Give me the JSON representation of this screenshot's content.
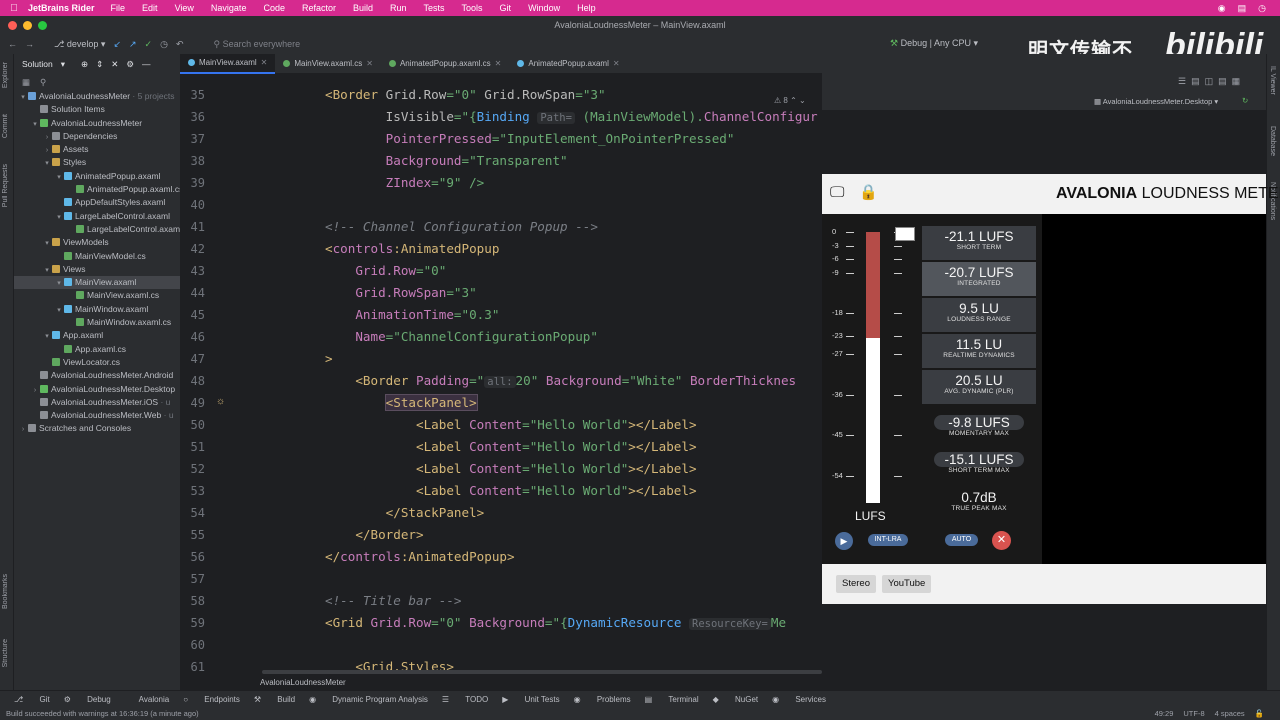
{
  "menubar": {
    "app": "JetBrains Rider",
    "items": [
      "File",
      "Edit",
      "View",
      "Navigate",
      "Code",
      "Refactor",
      "Build",
      "Run",
      "Tests",
      "Tools",
      "Git",
      "Window",
      "Help"
    ]
  },
  "window_title": "AvaloniaLoudnessMeter – MainView.axaml",
  "toolbar": {
    "branch": "develop",
    "search_placeholder": "Search everywhere",
    "run_config": "Debug | Any CPU"
  },
  "watermark": {
    "text": "明文传输不",
    "logo": "bilibili"
  },
  "sidebar": {
    "title": "Solution",
    "tree": [
      {
        "indent": 0,
        "arrow": "▾",
        "label": "AvaloniaLoudnessMeter",
        "suffix": " · 5 projects",
        "color": "#6aa0d8"
      },
      {
        "indent": 1,
        "arrow": "",
        "label": "Solution Items",
        "suffix": "",
        "color": "#8c8f95"
      },
      {
        "indent": 1,
        "arrow": "▾",
        "label": "AvaloniaLoudnessMeter",
        "suffix": "",
        "color": "#5fb85f"
      },
      {
        "indent": 2,
        "arrow": "›",
        "label": "Dependencies",
        "suffix": "",
        "color": "#8c8f95"
      },
      {
        "indent": 2,
        "arrow": "›",
        "label": "Assets",
        "suffix": "",
        "color": "#c9a24a"
      },
      {
        "indent": 2,
        "arrow": "▾",
        "label": "Styles",
        "suffix": "",
        "color": "#c9a24a"
      },
      {
        "indent": 3,
        "arrow": "▾",
        "label": "AnimatedPopup.axaml",
        "suffix": "",
        "color": "#5fb8e8"
      },
      {
        "indent": 4,
        "arrow": "",
        "label": "AnimatedPopup.axaml.cs",
        "suffix": "",
        "color": "#5fa85f"
      },
      {
        "indent": 3,
        "arrow": "",
        "label": "AppDefaultStyles.axaml",
        "suffix": "",
        "color": "#5fb8e8"
      },
      {
        "indent": 3,
        "arrow": "▾",
        "label": "LargeLabelControl.axaml",
        "suffix": "",
        "color": "#5fb8e8"
      },
      {
        "indent": 4,
        "arrow": "",
        "label": "LargeLabelControl.axaml.cs",
        "suffix": "",
        "color": "#5fa85f"
      },
      {
        "indent": 2,
        "arrow": "▾",
        "label": "ViewModels",
        "suffix": "",
        "color": "#c9a24a"
      },
      {
        "indent": 3,
        "arrow": "",
        "label": "MainViewModel.cs",
        "suffix": "",
        "color": "#5fa85f"
      },
      {
        "indent": 2,
        "arrow": "▾",
        "label": "Views",
        "suffix": "",
        "color": "#c9a24a"
      },
      {
        "indent": 3,
        "arrow": "▾",
        "label": "MainView.axaml",
        "suffix": "",
        "color": "#5fb8e8",
        "selected": true
      },
      {
        "indent": 4,
        "arrow": "",
        "label": "MainView.axaml.cs",
        "suffix": "",
        "color": "#5fa85f"
      },
      {
        "indent": 3,
        "arrow": "▾",
        "label": "MainWindow.axaml",
        "suffix": "",
        "color": "#5fb8e8"
      },
      {
        "indent": 4,
        "arrow": "",
        "label": "MainWindow.axaml.cs",
        "suffix": "",
        "color": "#5fa85f"
      },
      {
        "indent": 2,
        "arrow": "▾",
        "label": "App.axaml",
        "suffix": "",
        "color": "#5fb8e8"
      },
      {
        "indent": 3,
        "arrow": "",
        "label": "App.axaml.cs",
        "suffix": "",
        "color": "#5fa85f"
      },
      {
        "indent": 2,
        "arrow": "",
        "label": "ViewLocator.cs",
        "suffix": "",
        "color": "#5fa85f"
      },
      {
        "indent": 1,
        "arrow": "",
        "label": "AvaloniaLoudnessMeter.Android",
        "suffix": "",
        "color": "#8c8f95"
      },
      {
        "indent": 1,
        "arrow": "›",
        "label": "AvaloniaLoudnessMeter.Desktop",
        "suffix": "",
        "color": "#5fb85f"
      },
      {
        "indent": 1,
        "arrow": "",
        "label": "AvaloniaLoudnessMeter.iOS",
        "suffix": " · u",
        "color": "#8c8f95"
      },
      {
        "indent": 1,
        "arrow": "",
        "label": "AvaloniaLoudnessMeter.Web",
        "suffix": " · u",
        "color": "#8c8f95"
      },
      {
        "indent": 0,
        "arrow": "›",
        "label": "Scratches and Consoles",
        "suffix": "",
        "color": "#8c8f95"
      }
    ]
  },
  "tabs": [
    {
      "label": "MainView.axaml",
      "active": true
    },
    {
      "label": "MainView.axaml.cs",
      "active": false
    },
    {
      "label": "AnimatedPopup.axaml.cs",
      "active": false
    },
    {
      "label": "AnimatedPopup.axaml",
      "active": false
    }
  ],
  "preview": {
    "target": "AvaloniaLoudnessMeter.Desktop",
    "problems_badge": "8"
  },
  "editor": {
    "line_numbers": [
      "35",
      "36",
      "37",
      "38",
      "39",
      "40",
      "41",
      "42",
      "43",
      "44",
      "45",
      "46",
      "47",
      "48",
      "49",
      "50",
      "51",
      "52",
      "53",
      "54",
      "55",
      "56",
      "57",
      "58",
      "59",
      "60",
      "61"
    ],
    "lines": [
      [
        {
          "c": "t",
          "x": "<Border "
        },
        {
          "c": "a",
          "x": "Grid.Row"
        },
        {
          "c": "av",
          "x": "=\"0\" "
        },
        {
          "c": "a",
          "x": "Grid.RowSpan"
        },
        {
          "c": "av",
          "x": "=\"3\""
        }
      ],
      [
        {
          "c": "a",
          "x": "        IsVisible"
        },
        {
          "c": "av",
          "x": "=\"{"
        },
        {
          "c": "bluek",
          "x": "Binding "
        },
        {
          "c": "hint",
          "x": "Path="
        },
        {
          "c": "av",
          "x": " (MainViewModel)."
        },
        {
          "c": "purp",
          "x": "ChannelConfigur"
        }
      ],
      [
        {
          "c": "purp",
          "x": "        PointerPressed"
        },
        {
          "c": "av",
          "x": "=\"InputElement_OnPointerPressed\""
        }
      ],
      [
        {
          "c": "purp",
          "x": "        Background"
        },
        {
          "c": "av",
          "x": "=\"Transparent\""
        }
      ],
      [
        {
          "c": "purp",
          "x": "        ZIndex"
        },
        {
          "c": "av",
          "x": "=\"9\" />"
        }
      ],
      [],
      [
        {
          "c": "c",
          "x": "<!-- Channel Configuration Popup -->"
        }
      ],
      [
        {
          "c": "t",
          "x": "<"
        },
        {
          "c": "ns",
          "x": "controls"
        },
        {
          "c": "t",
          "x": ":AnimatedPopup"
        }
      ],
      [
        {
          "c": "purp",
          "x": "    Grid.Row"
        },
        {
          "c": "av",
          "x": "=\"0\""
        }
      ],
      [
        {
          "c": "purp",
          "x": "    Grid.RowSpan"
        },
        {
          "c": "av",
          "x": "=\"3\""
        }
      ],
      [
        {
          "c": "purp",
          "x": "    AnimationTime"
        },
        {
          "c": "av",
          "x": "=\"0.3\""
        }
      ],
      [
        {
          "c": "purp",
          "x": "    Name"
        },
        {
          "c": "av",
          "x": "=\"ChannelConfigurationPopup\""
        }
      ],
      [
        {
          "c": "t",
          "x": ">"
        }
      ],
      [
        {
          "c": "t",
          "x": "    <Border "
        },
        {
          "c": "purp",
          "x": "Padding"
        },
        {
          "c": "av",
          "x": "=\""
        },
        {
          "c": "hint",
          "x": "all:"
        },
        {
          "c": "av",
          "x": "20\" "
        },
        {
          "c": "purp",
          "x": "Background"
        },
        {
          "c": "av",
          "x": "=\"White\" "
        },
        {
          "c": "purp",
          "x": "BorderThicknes"
        }
      ],
      [
        {
          "c": "t",
          "x": "        "
        },
        {
          "c": "t hl",
          "x": "<StackPanel>"
        }
      ],
      [
        {
          "c": "t",
          "x": "            <Label "
        },
        {
          "c": "purp",
          "x": "Content"
        },
        {
          "c": "av",
          "x": "=\"Hello World\""
        },
        {
          "c": "t",
          "x": "></Label>"
        }
      ],
      [
        {
          "c": "t",
          "x": "            <Label "
        },
        {
          "c": "purp",
          "x": "Content"
        },
        {
          "c": "av",
          "x": "=\"Hello World\""
        },
        {
          "c": "t",
          "x": "></Label>"
        }
      ],
      [
        {
          "c": "t",
          "x": "            <Label "
        },
        {
          "c": "purp",
          "x": "Content"
        },
        {
          "c": "av",
          "x": "=\"Hello World\""
        },
        {
          "c": "t",
          "x": "></Label>"
        }
      ],
      [
        {
          "c": "t",
          "x": "            <Label "
        },
        {
          "c": "purp",
          "x": "Content"
        },
        {
          "c": "av",
          "x": "=\"Hello World\""
        },
        {
          "c": "t",
          "x": "></Label>"
        }
      ],
      [
        {
          "c": "t",
          "x": "        </StackPanel>"
        }
      ],
      [
        {
          "c": "t",
          "x": "    </Border>"
        }
      ],
      [
        {
          "c": "t",
          "x": "</"
        },
        {
          "c": "ns",
          "x": "controls"
        },
        {
          "c": "t",
          "x": ":AnimatedPopup>"
        }
      ],
      [],
      [
        {
          "c": "c",
          "x": "<!-- Title bar -->"
        }
      ],
      [
        {
          "c": "t",
          "x": "<Grid "
        },
        {
          "c": "purp",
          "x": "Grid.Row"
        },
        {
          "c": "av",
          "x": "=\"0\" "
        },
        {
          "c": "purp",
          "x": "Background"
        },
        {
          "c": "av",
          "x": "=\"{"
        },
        {
          "c": "bluek",
          "x": "DynamicResource "
        },
        {
          "c": "hint",
          "x": "ResourceKey="
        },
        {
          "c": "av",
          "x": "Me"
        }
      ],
      [],
      [
        {
          "c": "t",
          "x": "    <Grid.Styles>"
        }
      ]
    ]
  },
  "meter_app": {
    "title_bold": "AVALONIA",
    "title_rest": " LOUDNESS METER",
    "scale": [
      "0",
      "-3",
      "-6",
      "-9",
      "-18",
      "-23",
      "-27",
      "-36",
      "-45",
      "-54"
    ],
    "unit": "LUFS",
    "level_fraction": 0.39,
    "stats": [
      {
        "value": "-21.1 LUFS",
        "label": "SHORT TERM"
      },
      {
        "value": "-20.7 LUFS",
        "label": "INTEGRATED"
      },
      {
        "value": "9.5 LU",
        "label": "LOUDNESS RANGE"
      },
      {
        "value": "11.5 LU",
        "label": "REALTIME DYNAMICS"
      },
      {
        "value": "20.5 LU",
        "label": "AVG. DYNAMIC (PLR)"
      },
      {
        "value": "-9.8 LUFS",
        "label": "MOMENTARY MAX"
      },
      {
        "value": "-15.1 LUFS",
        "label": "SHORT TERM MAX"
      },
      {
        "value": "0.7dB",
        "label": "TRUE PEAK MAX"
      }
    ],
    "int_lra": "INT-LRA",
    "auto": "AUTO",
    "footer_buttons": [
      "Stereo",
      "YouTube"
    ],
    "colors": {
      "meter_red": "#b54c48",
      "pill": "#4a6b9a",
      "close": "#d9534f"
    }
  },
  "bottom_tools": [
    "Git",
    "Debug",
    "Avalonia",
    "Endpoints",
    "Build",
    "Dynamic Program Analysis",
    "TODO",
    "Unit Tests",
    "Problems",
    "Terminal",
    "NuGet",
    "Services"
  ],
  "navbar_crumb": "AvaloniaLoudnessMeter",
  "status": {
    "message": "Build succeeded with warnings at 16:36:19 (a minute ago)",
    "position": "49:29",
    "encoding": "UTF-8",
    "indent": "4 spaces"
  },
  "left_strip": [
    "Explorer",
    "Commit",
    "Pull Requests",
    "Bookmarks",
    "Structure"
  ],
  "right_strip": [
    "IL Viewer",
    "Database",
    "Notifications"
  ]
}
